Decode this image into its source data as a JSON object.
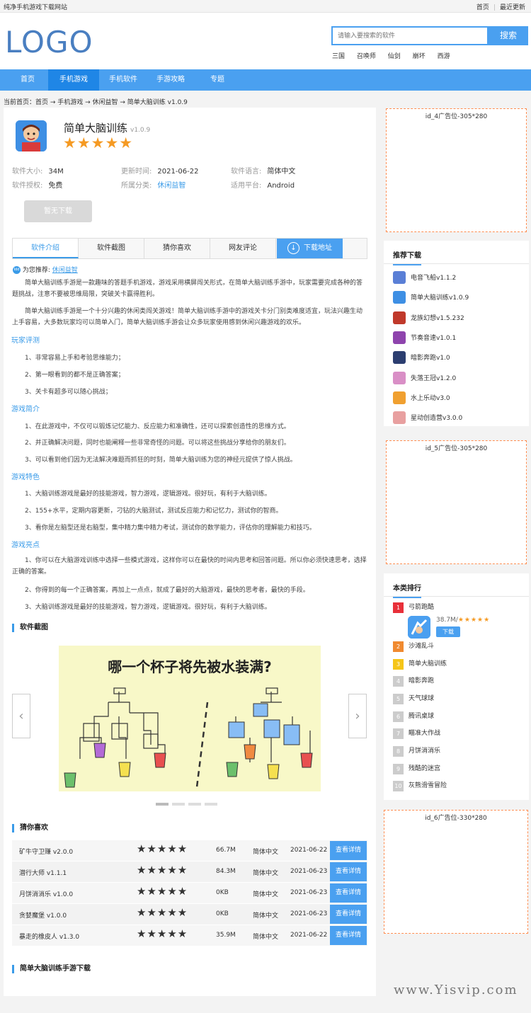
{
  "topbar": {
    "site_name": "纯净手机游戏下载网站",
    "links": [
      "首页",
      "最近更新"
    ]
  },
  "header": {
    "logo": "LOGO",
    "search_placeholder": "请输入要搜索的软件",
    "search_button": "搜索",
    "hot_words": [
      "三国",
      "召唤师",
      "仙剑",
      "崩坏",
      "西游"
    ]
  },
  "nav": {
    "items": [
      "首页",
      "手机游戏",
      "手机软件",
      "手游攻略",
      "专题"
    ],
    "active_index": 1
  },
  "breadcrumb": "当前首页：首页 → 手机游戏 → 休闲益智 → 简单大脑训练 v1.0.9",
  "app": {
    "name": "简单大脑训练",
    "version": "v1.0.9",
    "rating": 5,
    "stars": "★★★★★",
    "info": [
      {
        "label": "软件大小:",
        "value": "34M"
      },
      {
        "label": "更新时间:",
        "value": "2021-06-22"
      },
      {
        "label": "软件语言:",
        "value": "简体中文"
      },
      {
        "label": "软件授权:",
        "value": "免费"
      },
      {
        "label": "所属分类:",
        "value": "休闲益智"
      },
      {
        "label": "适用平台:",
        "value": "Android"
      }
    ],
    "download_disabled": "暂无下载"
  },
  "tabs": [
    "软件介绍",
    "软件截图",
    "猜你喜欢",
    "网友评论",
    "下载地址"
  ],
  "recommend": {
    "icon_text": "Idd",
    "label": "为您推荐:",
    "link": "休闲益智"
  },
  "intro": {
    "p1": "简单大脑训练手游是一款趣味的答题手机游戏，游戏采用横屏闯关形式，在简单大脑训练手游中，玩家需要完成各种的答题挑战，注意不要被思维局限，突破关卡赢得胜利。",
    "p2": "简单大脑训练手游是一个十分兴趣的休闲类闯关游戏！简单大脑训练手游中的游戏关卡分门别类难度适宜，玩法兴趣生动上手容易，大多数玩家均可以简单入门，简单大脑训练手游会让众多玩家使用感到休闲兴趣游戏的欢乐。",
    "sections": [
      {
        "title": "玩家评测",
        "items": [
          "1、非常容易上手和考验思维能力；",
          "2、第一眼看到的都不是正确答案；",
          "3、关卡有超多可以随心挑战；"
        ]
      },
      {
        "title": "游戏简介",
        "items": [
          "1、在此游戏中，不仅可以锻炼记忆能力、反应能力和准确性，还可以探索创造性的思维方式。",
          "2、并正确解决问题，同时也能阐释一些非常奇怪的问题。可以将这些挑战分享给你的朋友们。",
          "3、可以看到他们因为无法解决难题而抓狂的时刻，简单大脑训练为您的神经元提供了惊人挑战。"
        ]
      },
      {
        "title": "游戏特色",
        "items": [
          "1、大脑训练游戏是最好的技能游戏，智力游戏，逻辑游戏。很好玩，有利于大脑训练。",
          "2、155+水平，定期内容更新，刁钻的大脑测试，测试反应能力和记忆力，测试你的智商。",
          "3、看你是左脑型还是右脑型，集中精力集中精力考试，测试你的数学能力，评估你的理解能力和技巧。"
        ]
      },
      {
        "title": "游戏亮点",
        "items": [
          "1、你可以在大脑游戏训练中选择一些模式游戏，这样你可以在最快的时间内思考和回答问题。所以你必须快速思考，选择正确的答案。",
          "2、你得到的每一个正确答案，再加上一点点，就成了最好的大脑游戏，最快的思考者，最快的手段。",
          "3、大脑训练游戏是最好的技能游戏，智力游戏，逻辑游戏。很好玩，有利于大脑训练。"
        ]
      }
    ]
  },
  "screenshots": {
    "title": "软件截图",
    "caption": "哪一个杯子将先被水装满?",
    "active_dot": 0,
    "dot_count": 4
  },
  "guess": {
    "title": "猜你喜欢",
    "button": "查看详情",
    "rows": [
      {
        "name": "矿牛守卫赚 v2.0.0",
        "stars": "★★★★★",
        "size": "66.7M",
        "lang": "简体中文",
        "date": "2021-06-22"
      },
      {
        "name": "潜行大师 v1.1.1",
        "stars": "★★★★★",
        "size": "84.3M",
        "lang": "简体中文",
        "date": "2021-06-23"
      },
      {
        "name": "月饼消消乐 v1.0.0",
        "stars": "★★★★★",
        "size": "0KB",
        "lang": "简体中文",
        "date": "2021-06-23"
      },
      {
        "name": "贪婪魔堡 v1.0.0",
        "stars": "★★★★★",
        "size": "0KB",
        "lang": "简体中文",
        "date": "2021-06-23"
      },
      {
        "name": "暴走的橡皮人 v1.3.0",
        "stars": "★★★★★",
        "size": "35.9M",
        "lang": "简体中文",
        "date": "2021-06-22"
      }
    ]
  },
  "download_section_title": "简单大脑训练手游下载",
  "ads": {
    "ad4": "id_4广告位-305*280",
    "ad5": "id_5广告位-305*280",
    "ad6": "id_6广告位-330*280"
  },
  "side_recommend": {
    "title": "推荐下载",
    "items": [
      {
        "name": "电音飞船v1.1.2",
        "color": "#5a7fd6"
      },
      {
        "name": "简单大脑训练v1.0.9",
        "color": "#3e8fe4"
      },
      {
        "name": "龙族幻想v1.5.232",
        "color": "#c0392b"
      },
      {
        "name": "节奏音速v1.0.1",
        "color": "#8e44ad"
      },
      {
        "name": "暗影奔跑v1.0",
        "color": "#2c3e70"
      },
      {
        "name": "失落王冠v1.2.0",
        "color": "#d98fc6"
      },
      {
        "name": "水上乐动v3.0",
        "color": "#f0a030"
      },
      {
        "name": "星动创造营v3.0.0",
        "color": "#e8a0a0"
      }
    ]
  },
  "side_rank": {
    "title": "本类排行",
    "top": {
      "name": "弓箭跑酷",
      "meta": "38.7M/",
      "stars": "★★★★★",
      "button": "下载"
    },
    "items": [
      "沙滩乱斗",
      "简单大脑训练",
      "暗影奔跑",
      "天气球球",
      "腾讯桌球",
      "瞄准大作战",
      "月饼消消乐",
      "残酷的迷宫",
      "灰熊滑雪冒险"
    ],
    "rank_colors": [
      "#e8303a",
      "#f08a30",
      "#f5c518"
    ]
  },
  "watermark": "www.Yisvip.com"
}
